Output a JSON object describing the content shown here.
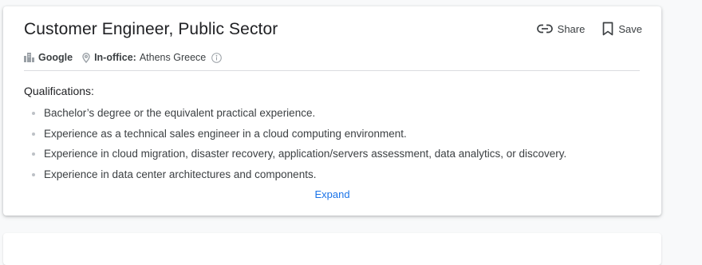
{
  "job": {
    "title": "Customer Engineer, Public Sector",
    "company": "Google",
    "work_mode": "In-office:",
    "location": "Athens Greece",
    "actions": {
      "share_label": "Share",
      "save_label": "Save"
    },
    "qualifications_heading": "Qualifications:",
    "qualifications": [
      "Bachelor’s degree or the equivalent practical experience.",
      "Experience as a technical sales engineer in a cloud computing environment.",
      "Experience in cloud migration, disaster recovery, application/servers assessment, data analytics, or discovery.",
      "Experience in data center architectures and components."
    ],
    "expand_label": "Expand"
  },
  "icons": {
    "company": "building-icon",
    "location": "location-pin-icon",
    "info": "info-icon",
    "share": "link-icon",
    "save": "bookmark-icon"
  },
  "colors": {
    "link": "#1a73e8",
    "text_primary": "#202124",
    "text_secondary": "#3c4043",
    "muted_icon": "#9aa0a6",
    "divider": "#dadce0"
  }
}
